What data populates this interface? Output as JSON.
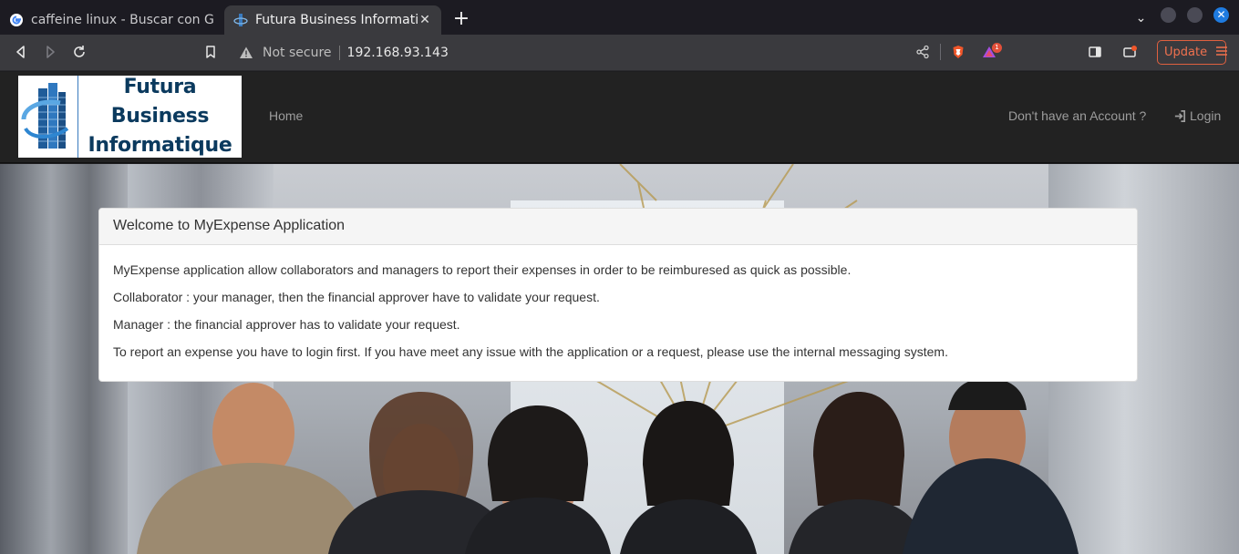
{
  "browser": {
    "tabs": [
      {
        "title": "caffeine linux - Buscar con Goo",
        "active": false,
        "favicon": "google-icon"
      },
      {
        "title": "Futura Business Informatiq",
        "active": true,
        "favicon": "futura-favicon"
      }
    ],
    "new_tab_label": "+",
    "url_security": "Not secure",
    "url": "192.168.93.143",
    "update_label": "Update",
    "shields_badge": "1",
    "accent_color": "#e0603f"
  },
  "site": {
    "logo": {
      "line1": "Futura Business",
      "line2": "Informatique"
    },
    "nav": {
      "home": "Home",
      "no_account": "Don't have an Account ?",
      "login": "Login"
    },
    "panel": {
      "heading": "Welcome to MyExpense Application",
      "paragraphs": [
        "MyExpense application allow collaborators and managers to report their expenses in order to be reimburesed as quick as possible.",
        "Collaborator : your manager, then the financial approver have to validate your request.",
        "Manager : the financial approver has to validate your request.",
        "To report an expense you have to login first. If you have meet any issue with the application or a request, please use the internal messaging system."
      ]
    }
  }
}
